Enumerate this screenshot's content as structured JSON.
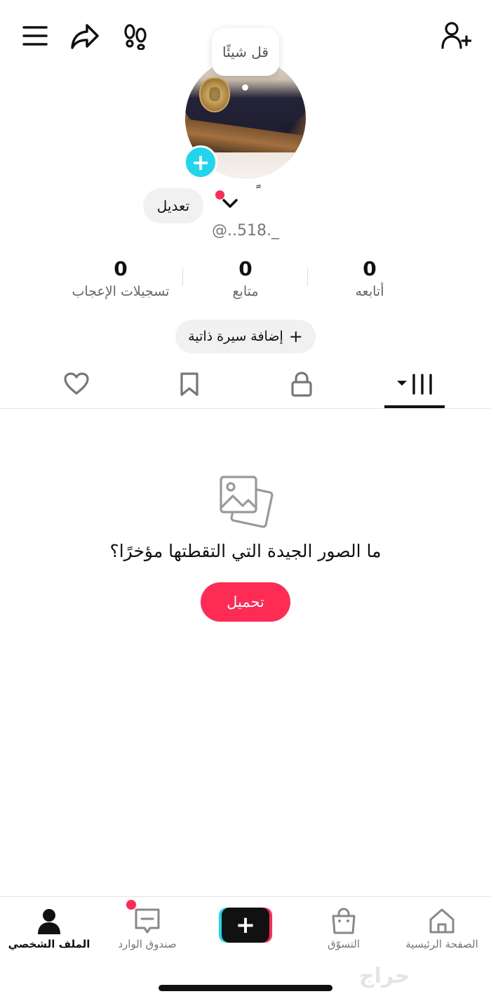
{
  "header": {
    "bubble_text": "قل شيئًا"
  },
  "profile": {
    "display_name": "ً",
    "edit_label": "تعديل",
    "handle": "@..518._",
    "add_bio_label": "إضافة سيرة ذاتية",
    "add_bio_plus": "+"
  },
  "stats": {
    "following": {
      "value": "0",
      "label": "أتابعه"
    },
    "followers": {
      "value": "0",
      "label": "متابع"
    },
    "likes": {
      "value": "0",
      "label": "تسجيلات الإعجاب"
    }
  },
  "tabs": {
    "active": "videos",
    "items": [
      "videos-grid",
      "private-lock",
      "favorites-bookmark",
      "liked-heart"
    ]
  },
  "empty_state": {
    "title": "ما الصور الجيدة التي التقطتها مؤخرًا؟",
    "upload_label": "تحميل"
  },
  "bottom_nav": {
    "home": "الصفحة الرئيسية",
    "shop": "التسوّق",
    "create": "+",
    "inbox": "صندوق الوارد",
    "profile": "الملف الشخصي"
  },
  "watermark": "حراج",
  "colors": {
    "accent_red": "#fe2c55",
    "accent_cyan": "#20d5ec",
    "chip_bg": "#f1f1f2"
  }
}
